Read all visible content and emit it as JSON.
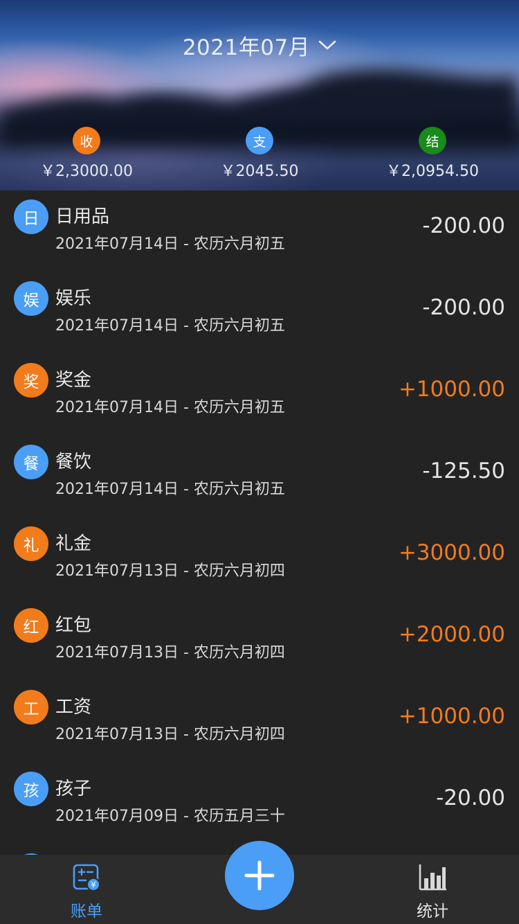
{
  "header": {
    "month_title": "2021年07月",
    "summary": [
      {
        "badge": "收",
        "amount": "￥2,3000.00",
        "color": "#f27b1c"
      },
      {
        "badge": "支",
        "amount": "￥2045.50",
        "color": "#4a9ef5"
      },
      {
        "badge": "结",
        "amount": "￥2,0954.50",
        "color": "#1a8a1a"
      }
    ]
  },
  "colors": {
    "accent_blue": "#4a9ef5",
    "income_orange": "#f27b1c",
    "background": "#232323"
  },
  "transactions": [
    {
      "icon_char": "日",
      "name": "日用品",
      "date": "2021年07月14日 - 农历六月初五",
      "amount": "-200.00",
      "type": "expense"
    },
    {
      "icon_char": "娱",
      "name": "娱乐",
      "date": "2021年07月14日 - 农历六月初五",
      "amount": "-200.00",
      "type": "expense"
    },
    {
      "icon_char": "奖",
      "name": "奖金",
      "date": "2021年07月14日 - 农历六月初五",
      "amount": "+1000.00",
      "type": "income"
    },
    {
      "icon_char": "餐",
      "name": "餐饮",
      "date": "2021年07月14日 - 农历六月初五",
      "amount": "-125.50",
      "type": "expense"
    },
    {
      "icon_char": "礼",
      "name": "礼金",
      "date": "2021年07月13日 - 农历六月初四",
      "amount": "+3000.00",
      "type": "income"
    },
    {
      "icon_char": "红",
      "name": "红包",
      "date": "2021年07月13日 - 农历六月初四",
      "amount": "+2000.00",
      "type": "income"
    },
    {
      "icon_char": "工",
      "name": "工资",
      "date": "2021年07月13日 - 农历六月初四",
      "amount": "+1000.00",
      "type": "income"
    },
    {
      "icon_char": "孩",
      "name": "孩子",
      "date": "2021年07月09日 - 农历五月三十",
      "amount": "-20.00",
      "type": "expense"
    }
  ],
  "tabbar": {
    "bill_label": "账单",
    "bill_icon": "bill-icon",
    "add_icon": "plus-icon",
    "stats_label": "统计",
    "stats_icon": "bar-chart-icon"
  }
}
